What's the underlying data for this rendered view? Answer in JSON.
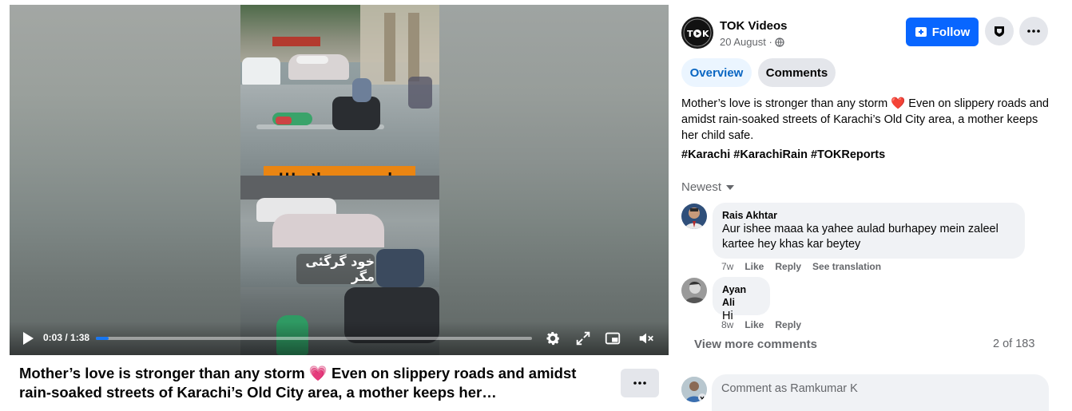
{
  "video": {
    "overlay_banner": "ماں تجھے سلام !!!",
    "overlay_caption": "خود گرگئی مگر",
    "time": "0:03 / 1:38",
    "progress_fraction": 0.019
  },
  "post": {
    "title_text": "Mother’s love is stronger than any storm 💗 Even on slippery roads and amidst rain-soaked streets of Karachi’s Old City area, a mother keeps her…",
    "author": "TOK Videos",
    "date": "20 August ·",
    "follow_label": "Follow",
    "tabs": [
      {
        "label": "Overview",
        "active": true
      },
      {
        "label": "Comments",
        "active": false
      }
    ],
    "description": "Mother’s love is stronger than any storm ❤️ Even on slippery roads and amidst rain-soaked streets of Karachi’s Old City area, a mother keeps her child safe.",
    "hashtags": "#Karachi #KarachiRain #TOKReports"
  },
  "comments_section": {
    "sort_label": "Newest",
    "comments": [
      {
        "name": "Rais Akhtar",
        "text": "Aur ishee maaa ka yahee aulad burhapey mein zaleel kartee hey khas kar beytey",
        "age": "7w",
        "like": "Like",
        "reply": "Reply",
        "translate": "See translation"
      },
      {
        "name": "Ayan Ali",
        "text": "Hi",
        "age": "8w",
        "like": "Like",
        "reply": "Reply"
      }
    ],
    "view_more": "View more comments",
    "count": "2 of 183",
    "input_placeholder": "Comment as Ramkumar K"
  },
  "colors": {
    "accent": "#0866ff",
    "tab_active_bg": "#ebf5ff",
    "tab_active_text": "#0a66c2",
    "banner": "#ea8512"
  },
  "icons": [
    "play-icon",
    "settings-icon",
    "fullscreen-icon",
    "pip-icon",
    "volume-muted-icon",
    "globe-icon",
    "follow-plus-icon",
    "shield-icon",
    "more-icon",
    "dropdown-caret-icon"
  ]
}
